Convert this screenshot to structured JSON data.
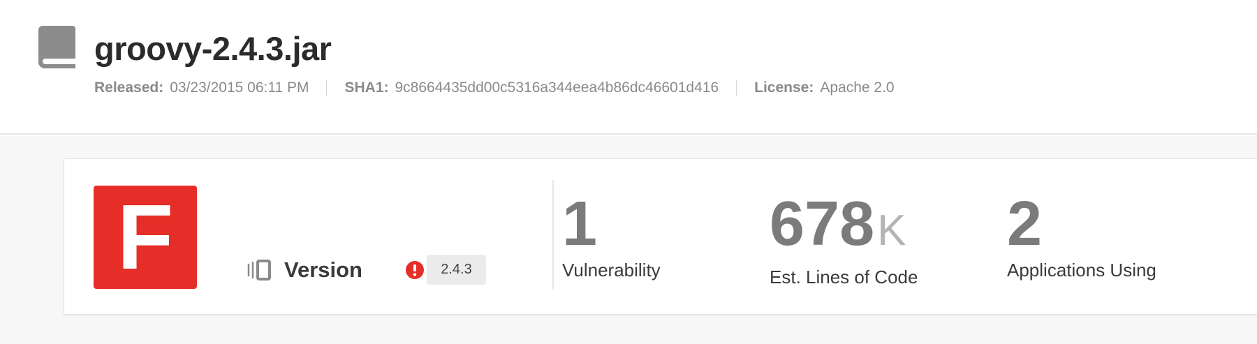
{
  "header": {
    "title": "groovy-2.4.3.jar",
    "icon": "book-icon",
    "meta": {
      "released_label": "Released:",
      "released_value": "03/23/2015 06:11 PM",
      "sha1_label": "SHA1:",
      "sha1_value": "9c8664435dd00c5316a344eea4b86dc46601d416",
      "license_label": "License:",
      "license_value": "Apache 2.0"
    }
  },
  "summary": {
    "grade": "F",
    "grade_color": "#e52e27",
    "version_label": "Version",
    "version_icon": "versions-icon",
    "warning_icon": "warning-icon",
    "warning_color": "#e52e27",
    "version_value": "2.4.3",
    "stats": [
      {
        "value": "1",
        "unit": "",
        "label": "Vulnerability"
      },
      {
        "value": "678",
        "unit": "K",
        "label": "Est. Lines of Code"
      },
      {
        "value": "2",
        "unit": "",
        "label": "Applications Using"
      }
    ]
  }
}
